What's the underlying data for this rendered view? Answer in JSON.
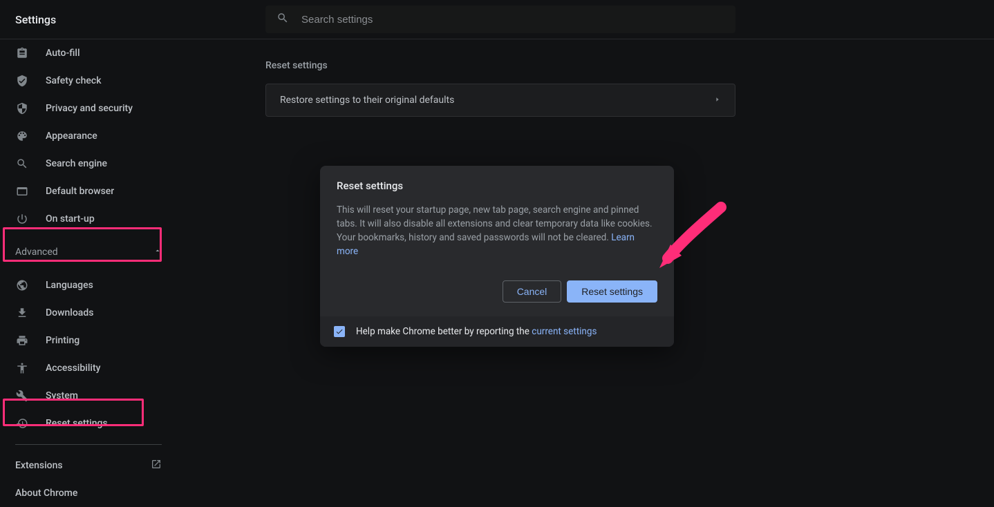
{
  "header": {
    "title": "Settings",
    "search_placeholder": "Search settings"
  },
  "sidebar": {
    "basic_items": [
      {
        "icon": "assignment",
        "label": "Auto-fill"
      },
      {
        "icon": "verified",
        "label": "Safety check"
      },
      {
        "icon": "security",
        "label": "Privacy and security"
      },
      {
        "icon": "palette",
        "label": "Appearance"
      },
      {
        "icon": "search",
        "label": "Search engine"
      },
      {
        "icon": "web",
        "label": "Default browser"
      },
      {
        "icon": "power",
        "label": "On start-up"
      }
    ],
    "advanced_label": "Advanced",
    "advanced_items": [
      {
        "icon": "language",
        "label": "Languages"
      },
      {
        "icon": "download",
        "label": "Downloads"
      },
      {
        "icon": "print",
        "label": "Printing"
      },
      {
        "icon": "accessibility",
        "label": "Accessibility"
      },
      {
        "icon": "build",
        "label": "System"
      },
      {
        "icon": "restore",
        "label": "Reset settings"
      }
    ],
    "extensions_label": "Extensions",
    "about_label": "About Chrome"
  },
  "main": {
    "section_title": "Reset settings",
    "row_label": "Restore settings to their original defaults"
  },
  "dialog": {
    "title": "Reset settings",
    "body": "This will reset your startup page, new tab page, search engine and pinned tabs. It will also disable all extensions and clear temporary data like cookies. Your bookmarks, history and saved passwords will not be cleared. ",
    "learn_more": "Learn more",
    "cancel": "Cancel",
    "confirm": "Reset settings",
    "footer_text": "Help make Chrome better by reporting the ",
    "footer_link": "current settings"
  }
}
